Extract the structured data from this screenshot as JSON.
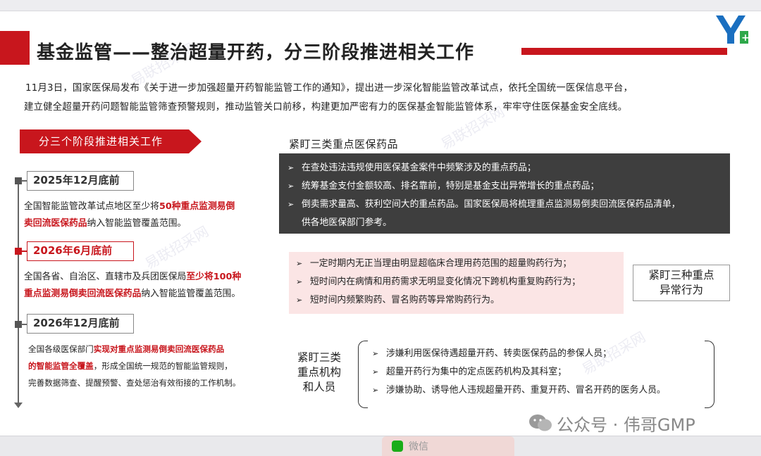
{
  "slide": {
    "title": "基金监管——整治超量开药，分三阶段推进相关工作",
    "intro_line1": "11月3日，国家医保局发布《关于进一步加强超量开药智能监管工作的通知》，提出进一步深化智能监管改革试点，依托全国统一医保信息平台，",
    "intro_line2": "建立健全超量开药问题智能监管筛查预警规则，推动监管关口前移，构建更加严密有力的医保基金智能监管体系，牢牢守住医保基金安全底线。",
    "watermark_text": "易联招采网"
  },
  "phases": {
    "header": "分三个阶段推进相关工作",
    "items": [
      {
        "date": "2025年12月底前",
        "text_a": "全国智能监管改革试点地区至少将",
        "highlight_1": "50种重点监测易倒",
        "highlight_2": "卖回流医保药品",
        "text_b": "纳入智能监管覆盖范围。"
      },
      {
        "date": "2026年6月底前",
        "text_a": "全国各省、自治区、直辖市及兵团医保局",
        "highlight_1": "至少将100种",
        "highlight_2": "重点监测易倒卖回流医保药品",
        "text_b": "纳入智能监管覆盖范围。"
      },
      {
        "date": "2026年12月底前",
        "text_a": "全国各级医保部门",
        "highlight_1": "实现对重点监测易倒卖回流医保药品",
        "highlight_2": "的智能监管全覆盖",
        "text_b": "，形成全国统一规范的智能监管规则，",
        "text_c": "完善数据筛查、提醒预警、查处惩治有效衔接的工作机制。"
      }
    ]
  },
  "drugs": {
    "title": "紧盯三类重点医保药品",
    "bullets": [
      "在查处违法违规使用医保基金案件中频繁涉及的重点药品；",
      "统筹基金支付金额较高、排名靠前，特别是基金支出异常增长的重点药品；",
      "倒卖需求量高、获利空间大的重点药品。国家医保局将梳理重点监测易倒卖回流医保药品清单，"
    ],
    "bullet3_cont": "供各地医保部门参考。"
  },
  "behaviors": {
    "label_1": "紧盯三种重点",
    "label_2": "异常行为",
    "bullets": [
      "一定时期内无正当理由明显超临床合理用药范围的超量购药行为；",
      "短时间内在病情和用药需求无明显变化情况下跨机构重复购药行为；",
      "短时间内频繁购药、冒名购药等异常购药行为。"
    ]
  },
  "institutions": {
    "label_1": "紧盯三类",
    "label_2": "重点机构",
    "label_3": "和人员",
    "bullets": [
      "涉嫌利用医保待遇超量开药、转卖医保药品的参保人员；",
      "超量开药行为集中的定点医药机构及其科室；",
      "涉嫌协助、诱导他人违规超量开药、重复开药、冒名开药的医务人员。"
    ]
  },
  "footer": {
    "account_text": "公众号 · 伟哥GMP",
    "wechat_tab_label": "微信"
  },
  "bullet_marker": "➢",
  "colors": {
    "accent": "#c8161d",
    "dark_box": "#3e3e3e",
    "pink_box": "#fbe5e5"
  }
}
